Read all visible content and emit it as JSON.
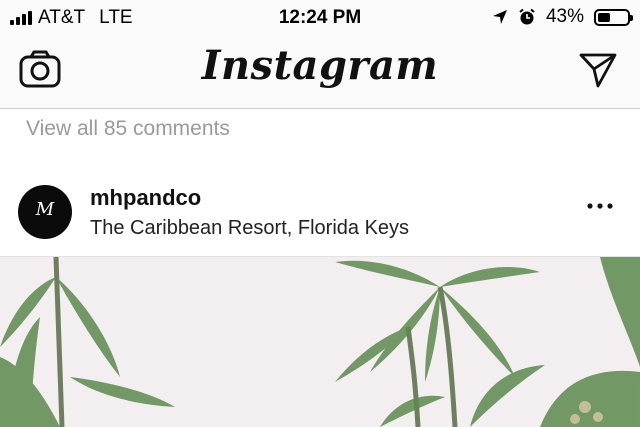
{
  "status_bar": {
    "carrier": "AT&T",
    "network": "LTE",
    "time": "12:24 PM",
    "battery_percent": "43%",
    "battery_level": 0.43,
    "signal_bars": 4
  },
  "nav": {
    "logo": "Instagram",
    "left_icon": "camera-icon",
    "right_icon": "direct-send-icon"
  },
  "feed": {
    "view_comments": "View all 85 comments",
    "post": {
      "username": "mhpandco",
      "location": "The Caribbean Resort, Florida Keys",
      "avatar_text": "M"
    }
  },
  "colors": {
    "bar_bg": "#fafafa",
    "muted_text": "#9a9a9a",
    "photo_sky": "#f3eef0",
    "palm_green": "#5c8a4e"
  }
}
